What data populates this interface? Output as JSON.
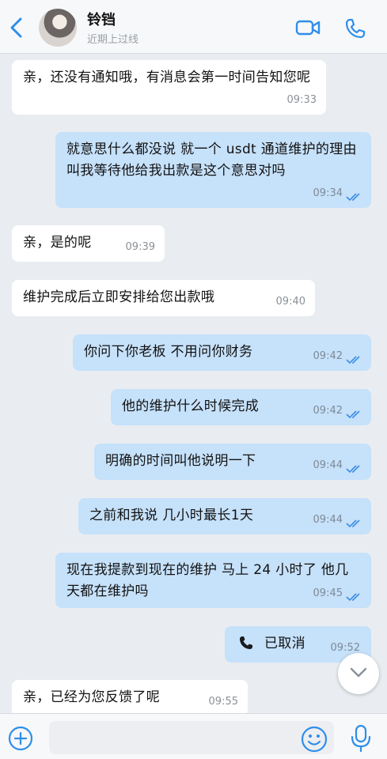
{
  "header": {
    "name": "铃铛",
    "status": "近期上过线"
  },
  "messages": [
    {
      "dir": "in",
      "text": "亲，还没有通知哦，有消息会第一时间告知您呢",
      "time": "09:33"
    },
    {
      "dir": "out",
      "text": "就意思什么都没说 就一个 usdt 通道维护的理由叫我等待他给我出款是这个意思对吗",
      "time": "09:34"
    },
    {
      "dir": "in",
      "text": "亲，是的呢",
      "time": "09:39"
    },
    {
      "dir": "in",
      "text": "维护完成后立即安排给您出款哦",
      "time": "09:40"
    },
    {
      "dir": "out",
      "text": "你问下你老板 不用问你财务",
      "time": "09:42"
    },
    {
      "dir": "out",
      "text": "他的维护什么时候完成",
      "time": "09:42"
    },
    {
      "dir": "out",
      "text": "明确的时间叫他说明一下",
      "time": "09:44"
    },
    {
      "dir": "out",
      "text": "之前和我说 几小时最长1天",
      "time": "09:44"
    },
    {
      "dir": "out",
      "text": "现在我提款到现在的维护 马上 24 小时了 他几天都在维护吗",
      "time": "09:45"
    },
    {
      "dir": "out",
      "text": "已取消",
      "time": "09:52",
      "call": true
    },
    {
      "dir": "in",
      "text": "亲，已经为您反馈了呢",
      "time": "09:55"
    }
  ],
  "composer": {
    "placeholder": ""
  },
  "colors": {
    "accent": "#2f8ee9",
    "outgoing_bubble": "#c6e1fa",
    "incoming_bubble": "#ffffff",
    "background": "#e9edf1"
  },
  "icons": [
    "back-arrow-icon",
    "video-call-icon",
    "phone-icon",
    "double-check-icon",
    "chevron-down-icon",
    "plus-circle-icon",
    "emoji-icon",
    "microphone-icon"
  ]
}
